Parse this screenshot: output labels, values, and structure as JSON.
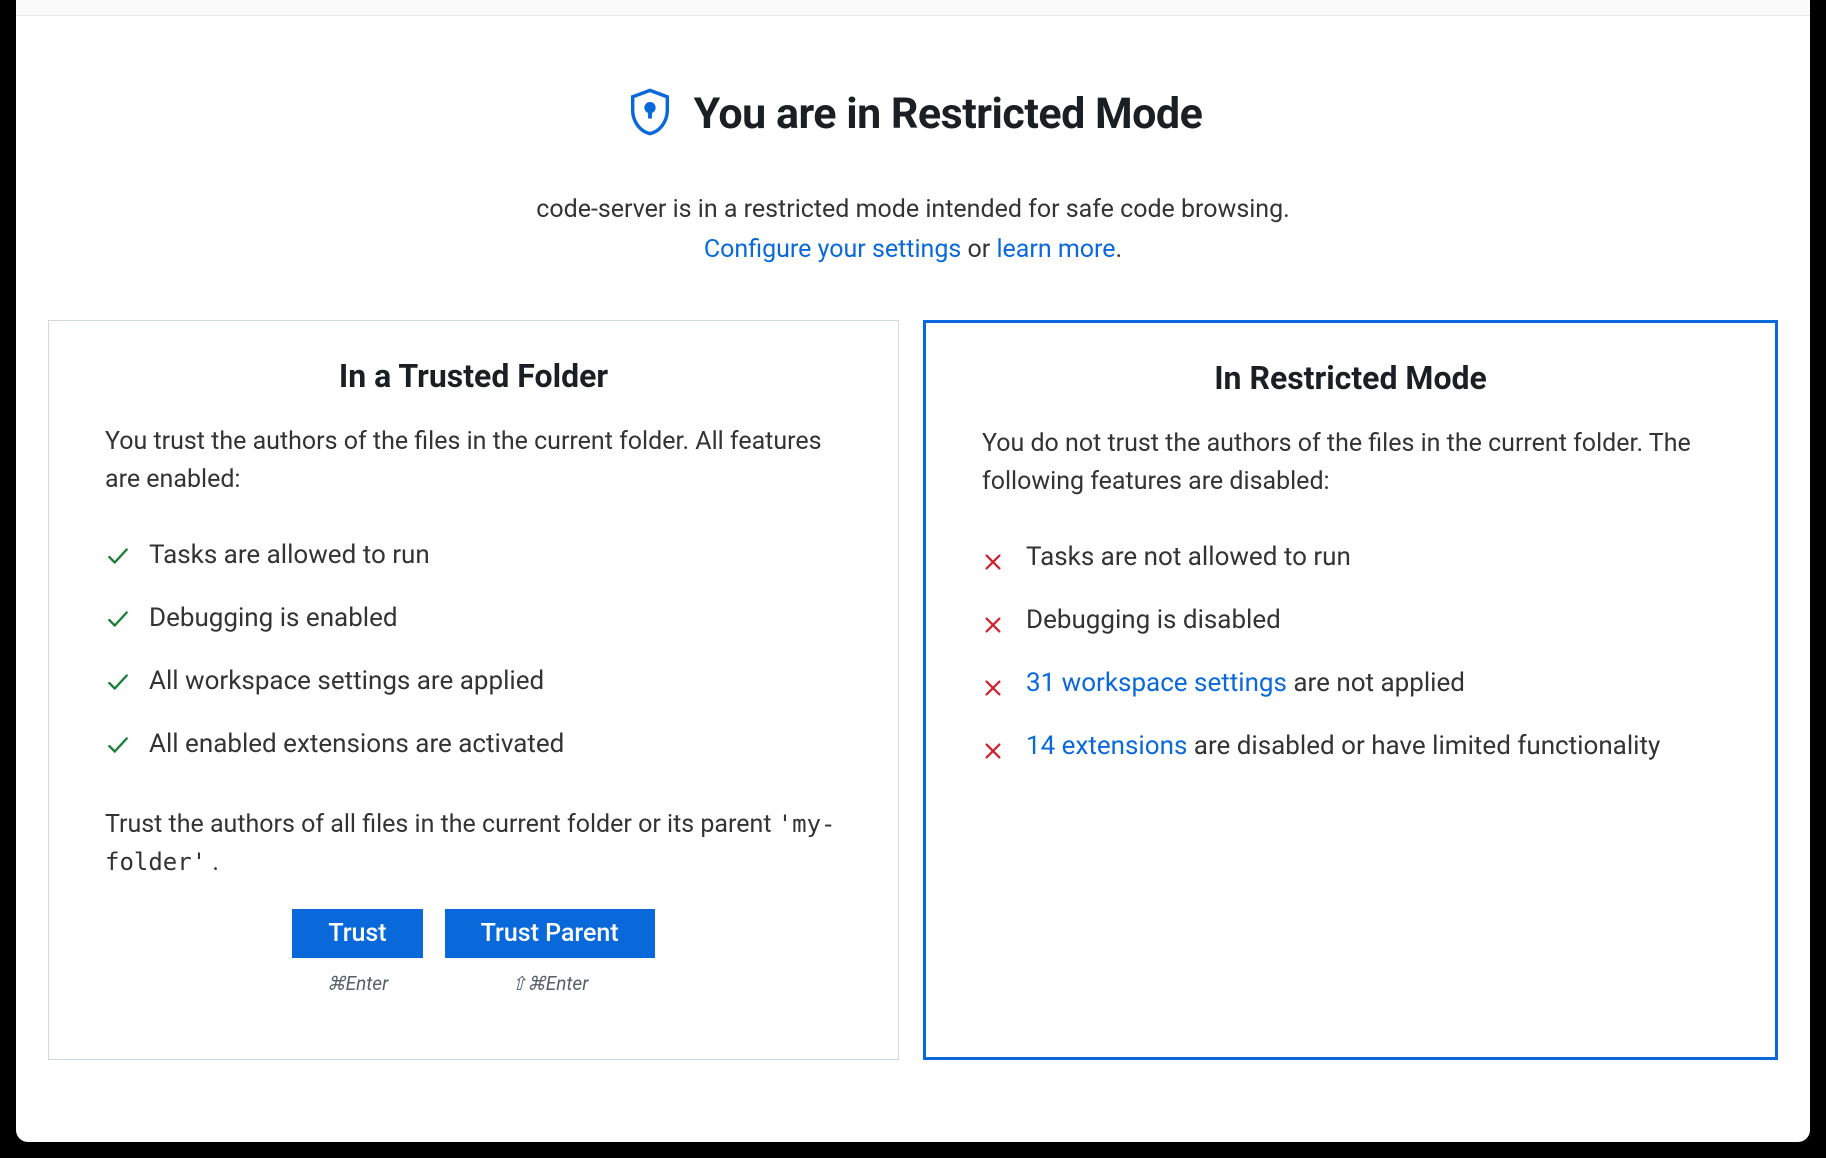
{
  "header": {
    "title": "You are in Restricted Mode",
    "desc": "code-server is in a restricted mode intended for safe code browsing.",
    "configure_link": "Configure your settings",
    "or_text": " or ",
    "learn_link": "learn more",
    "period": "."
  },
  "trusted": {
    "title": "In a Trusted Folder",
    "desc": "You trust the authors of the files in the current folder. All features are enabled:",
    "items": [
      {
        "text": "Tasks are allowed to run"
      },
      {
        "text": "Debugging is enabled"
      },
      {
        "text": "All workspace settings are applied"
      },
      {
        "text": "All enabled extensions are activated"
      }
    ],
    "prompt_pre": "Trust the authors of all files in the current folder or its parent ",
    "folder_name": "'my-folder'",
    "prompt_post": " .",
    "trust_btn": "Trust",
    "trust_shortcut": "⌘Enter",
    "trust_parent_btn": "Trust Parent",
    "trust_parent_shortcut": "⇧⌘Enter"
  },
  "restricted": {
    "title": "In Restricted Mode",
    "desc": "You do not trust the authors of the files in the current folder. The following features are disabled:",
    "items": [
      {
        "text": "Tasks are not allowed to run"
      },
      {
        "text": "Debugging is disabled"
      },
      {
        "link": "31 workspace settings",
        "suffix": " are not applied"
      },
      {
        "link": "14 extensions",
        "suffix": " are disabled or have limited functionality"
      }
    ]
  }
}
